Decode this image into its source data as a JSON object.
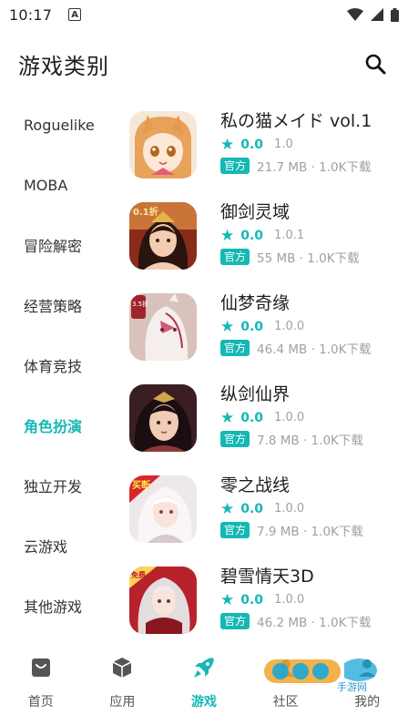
{
  "status_bar": {
    "time": "10:17",
    "notification_letter": "A"
  },
  "header": {
    "title": "游戏类别"
  },
  "categories": [
    {
      "label": "Roguelike",
      "active": false
    },
    {
      "label": "MOBA",
      "active": false
    },
    {
      "label": "冒险解密",
      "active": false
    },
    {
      "label": "经营策略",
      "active": false
    },
    {
      "label": "体育竞技",
      "active": false
    },
    {
      "label": "角色扮演",
      "active": true
    },
    {
      "label": "独立开发",
      "active": false
    },
    {
      "label": "云游戏",
      "active": false
    },
    {
      "label": "其他游戏",
      "active": false
    }
  ],
  "games": [
    {
      "name": "私の猫メイド vol.1",
      "rating": "0.0",
      "version": "1.0",
      "badge": "官方",
      "size": "21.7 MB · 1.0K下载"
    },
    {
      "name": "御剑灵域",
      "rating": "0.0",
      "version": "1.0.1",
      "badge": "官方",
      "size": "55 MB · 1.0K下载"
    },
    {
      "name": "仙梦奇缘",
      "rating": "0.0",
      "version": "1.0.0",
      "badge": "官方",
      "size": "46.4 MB · 1.0K下载"
    },
    {
      "name": "纵剑仙界",
      "rating": "0.0",
      "version": "1.0.0",
      "badge": "官方",
      "size": "7.8 MB · 1.0K下载"
    },
    {
      "name": "零之战线",
      "rating": "0.0",
      "version": "1.0.0",
      "badge": "官方",
      "size": "7.9 MB · 1.0K下载"
    },
    {
      "name": "碧雪情天3D",
      "rating": "0.0",
      "version": "1.0.0",
      "badge": "官方",
      "size": "46.2 MB · 1.0K下载"
    }
  ],
  "icon_labels": {
    "game2": "0.1折",
    "game3": "3.5折",
    "game5": "买断",
    "game6": "免费"
  },
  "bottom_nav": [
    {
      "label": "首页",
      "icon": "home-bag-icon",
      "active": false
    },
    {
      "label": "应用",
      "icon": "cube-icon",
      "active": false
    },
    {
      "label": "游戏",
      "icon": "rocket-icon",
      "active": true
    },
    {
      "label": "社区",
      "icon": "community-icon",
      "active": false
    },
    {
      "label": "我的",
      "icon": "profile-icon",
      "active": false
    }
  ],
  "watermark": {
    "text": "手游网"
  },
  "colors": {
    "accent": "#14b8b4",
    "active_bg": "#dff5f4",
    "muted": "#a0a0a0"
  }
}
